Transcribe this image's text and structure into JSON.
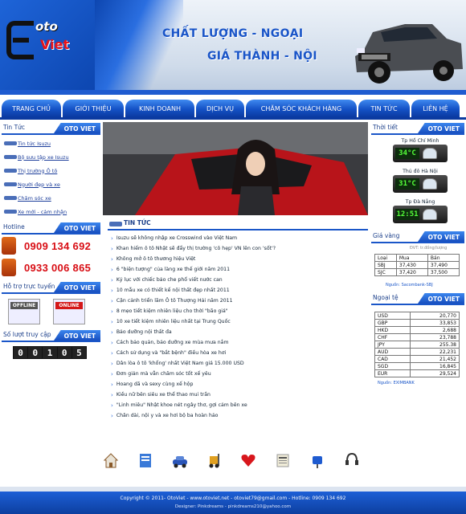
{
  "header": {
    "logo_top": "oto",
    "logo_bottom": "Viet",
    "slogan_line1": "CHẤT LƯỢNG - NGOẠI",
    "slogan_line2": "GIÁ THÀNH - NỘI"
  },
  "nav": [
    "TRANG CHỦ",
    "GIỚI THIỆU",
    "KINH DOANH",
    "DỊCH VỤ",
    "CHĂM SÓC KHÁCH HÀNG",
    "TIN TỨC",
    "LIÊN HỆ"
  ],
  "left": {
    "news_box": {
      "title": "Tin Tức",
      "brand": "OTO VIET"
    },
    "news_items": [
      "Tin tức Isuzu",
      "Bộ sưu tập xe Isuzu",
      "Thị trường Ô tô",
      "Người đẹp và xe",
      "Chăm sóc xe",
      "Xe mới - cảm nhận"
    ],
    "hotline_box": {
      "title": "Hotline",
      "brand": "OTO VIET"
    },
    "phones": [
      "0909 134 692",
      "0933 006 865"
    ],
    "support_box": {
      "title": "Hỗ trợ trực tuyến",
      "brand": "OTO VIET"
    },
    "support_badges": [
      "OFFLINE",
      "ONLINE"
    ],
    "visits_box": {
      "title": "Số lượt truy cập",
      "brand": "OTO VIET"
    },
    "counter_digits": [
      "0",
      "0",
      "1",
      "0",
      "5"
    ]
  },
  "center": {
    "section_title": "TIN TỨC",
    "articles": [
      "Isuzu sẽ không nhập xe Crosswind vào Việt Nam",
      "Khan hiếm ô tô Nhật sẽ đẩy thị trường 'cô hẹp' VN lên con 'sốt'?",
      "Không mở ô tô thương hiệu Việt",
      "6 \"biện tượng\" của làng xe thế giới năm 2011",
      "Kỷ lục với chiếc bảo che phổ viết nước can",
      "10 mẫu xe có thiết kế nội thất đẹp nhất 2011",
      "Cận cảnh triển lãm Ô tô Thượng Hải năm 2011",
      "8 mẹo tiết kiệm nhiên liệu cho thời \"bão giá\"",
      "10 xe tiết kiệm nhiên liệu nhất tại Trung Quốc",
      "Bảo dưỡng nội thất đa",
      "Cách bảo quản, bảo dưỡng xe mùa mưa nắm",
      "Cách sử dụng và \"bắt bệnh\" điều hòa xe hơi",
      "Dân lòa ô tô 'khổng' nhất Việt Nam giá 15.000 USD",
      "Đơn giản mà vẫn chăm sóc tốt xế yêu",
      "Hoang dã và sexy cùng xế hộp",
      "Kiều nữ bên siêu xe thể thao mui trần",
      "\"Linh miêu\" Nhật khoe nét ngây thơ, gợi cảm bên xe",
      "Chân dài, nội y và xe hơi bộ ba hoàn hảo"
    ],
    "bottom_icons": [
      "home-icon",
      "document-icon",
      "car-icon",
      "forklift-icon",
      "heart-icon",
      "news-icon",
      "mailbox-icon",
      "headset-icon"
    ]
  },
  "right": {
    "time_box": {
      "title": "Thời tiết",
      "brand": "OTO VIET"
    },
    "cities": [
      {
        "name": "Tp Hồ Chí Minh",
        "temp": "34°C"
      },
      {
        "name": "Thủ đô Hà Nội",
        "temp": "31°C"
      },
      {
        "name": "Tp Đà Nẵng",
        "temp": "12:51"
      }
    ],
    "gold_box": {
      "title": "Giá vàng",
      "brand": "OTO VIET"
    },
    "gold_unit": "ĐVT: tr.đồng/lượng",
    "gold_rows": [
      [
        "Loại",
        "Mua",
        "Bán"
      ],
      [
        "SBJ",
        "37,430",
        "37,490"
      ],
      [
        "SJC",
        "37,420",
        "37,500"
      ]
    ],
    "gold_source": "Nguồn: Sacombank-SBJ",
    "fx_box": {
      "title": "Ngoại tệ",
      "brand": "OTO VIET"
    },
    "fx_rows": [
      [
        "USD",
        "20,770"
      ],
      [
        "GBP",
        "33,853"
      ],
      [
        "HKD",
        "2,688"
      ],
      [
        "CHF",
        "23,788"
      ],
      [
        "JPY",
        "255.38"
      ],
      [
        "AUD",
        "22,231"
      ],
      [
        "CAD",
        "21,452"
      ],
      [
        "SGD",
        "16,845"
      ],
      [
        "EUR",
        "29,524"
      ]
    ],
    "fx_source": "Nguồn: EXIMBANK"
  },
  "footer": {
    "line1": "Copyright © 2011- OtoViet - www.otoviet.net - otoviet79@gmail.com - Hotline: 0909 134 692",
    "line2": "Designer: Pinkdreams - pinkdreams210@yahoo.com"
  },
  "colors": {
    "brand_blue": "#1a56c8",
    "hotline_red": "#d80d14",
    "nav_blue": "#1451c5"
  }
}
